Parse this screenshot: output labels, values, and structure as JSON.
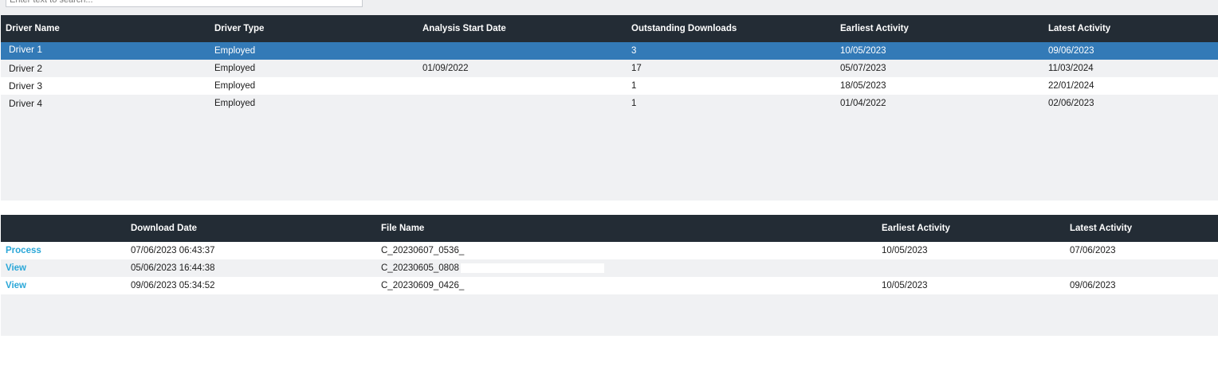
{
  "search": {
    "placeholder": "Enter text to search..."
  },
  "drivers_table": {
    "columns": [
      "Driver Name",
      "Driver Type",
      "Analysis Start Date",
      "Outstanding Downloads",
      "Earliest Activity",
      "Latest Activity"
    ],
    "rows": [
      {
        "name": "Driver 1",
        "type": "Employed",
        "start": "",
        "outstanding": "3",
        "earliest": "10/05/2023",
        "latest": "09/06/2023"
      },
      {
        "name": "Driver 2",
        "type": "Employed",
        "start": "01/09/2022",
        "outstanding": "17",
        "earliest": "05/07/2023",
        "latest": "11/03/2024"
      },
      {
        "name": "Driver 3",
        "type": "Employed",
        "start": "",
        "outstanding": "1",
        "earliest": "18/05/2023",
        "latest": "22/01/2024"
      },
      {
        "name": "Driver 4",
        "type": "Employed",
        "start": "",
        "outstanding": "1",
        "earliest": "01/04/2022",
        "latest": "02/06/2023"
      }
    ]
  },
  "downloads_table": {
    "columns": [
      "",
      "Download Date",
      "File Name",
      "Earliest Activity",
      "Latest Activity"
    ],
    "rows": [
      {
        "action": "Process",
        "date": "07/06/2023 06:43:37",
        "file": "C_20230607_0536_",
        "earliest": "10/05/2023",
        "latest": "07/06/2023"
      },
      {
        "action": "View",
        "date": "05/06/2023 16:44:38",
        "file": "C_20230605_0808",
        "earliest": "",
        "latest": ""
      },
      {
        "action": "View",
        "date": "09/06/2023 05:34:52",
        "file": "C_20230609_0426_",
        "earliest": "10/05/2023",
        "latest": "09/06/2023"
      }
    ]
  },
  "colors": {
    "header_bg": "#232c35",
    "selected_row": "#337ab7",
    "link": "#2aa7d8",
    "grid_bg": "#f0f1f3"
  }
}
